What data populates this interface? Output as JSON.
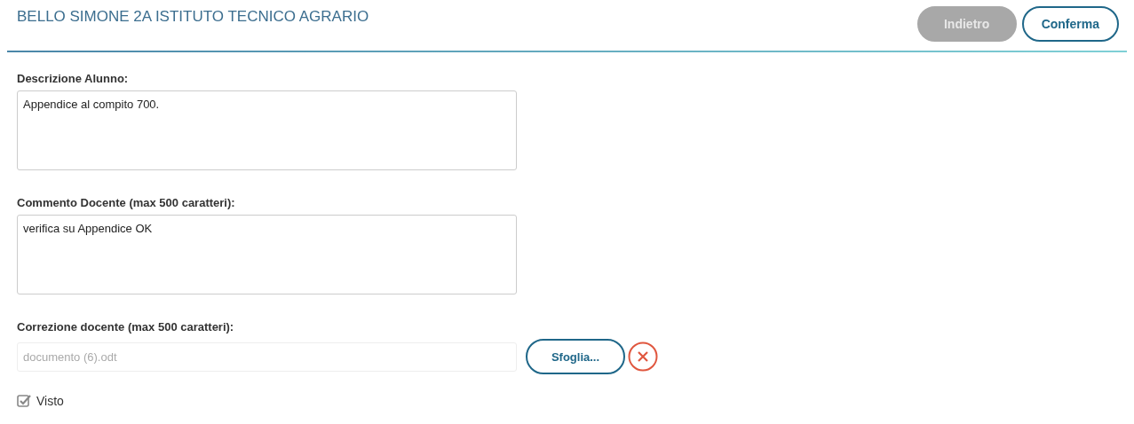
{
  "header": {
    "title": "BELLO SIMONE 2A ISTITUTO TECNICO AGRARIO",
    "buttons": [
      {
        "label": "Indietro",
        "disabled": true
      },
      {
        "label": "Conferma",
        "disabled": false
      }
    ]
  },
  "fields": [
    {
      "kind": "textarea",
      "label": "Descrizione Alunno:",
      "value": "Appendice al compito 700."
    },
    {
      "kind": "textarea",
      "label": "Commento Docente (max 500 caratteri):",
      "value": "verifica su Appendice OK"
    },
    {
      "kind": "file",
      "label": "Correzione docente (max 500 caratteri):",
      "value": "documento (6).odt",
      "disabled": true,
      "browse_label": "Sfoglia..."
    }
  ],
  "visto": {
    "label": "Visto",
    "checked": true
  }
}
